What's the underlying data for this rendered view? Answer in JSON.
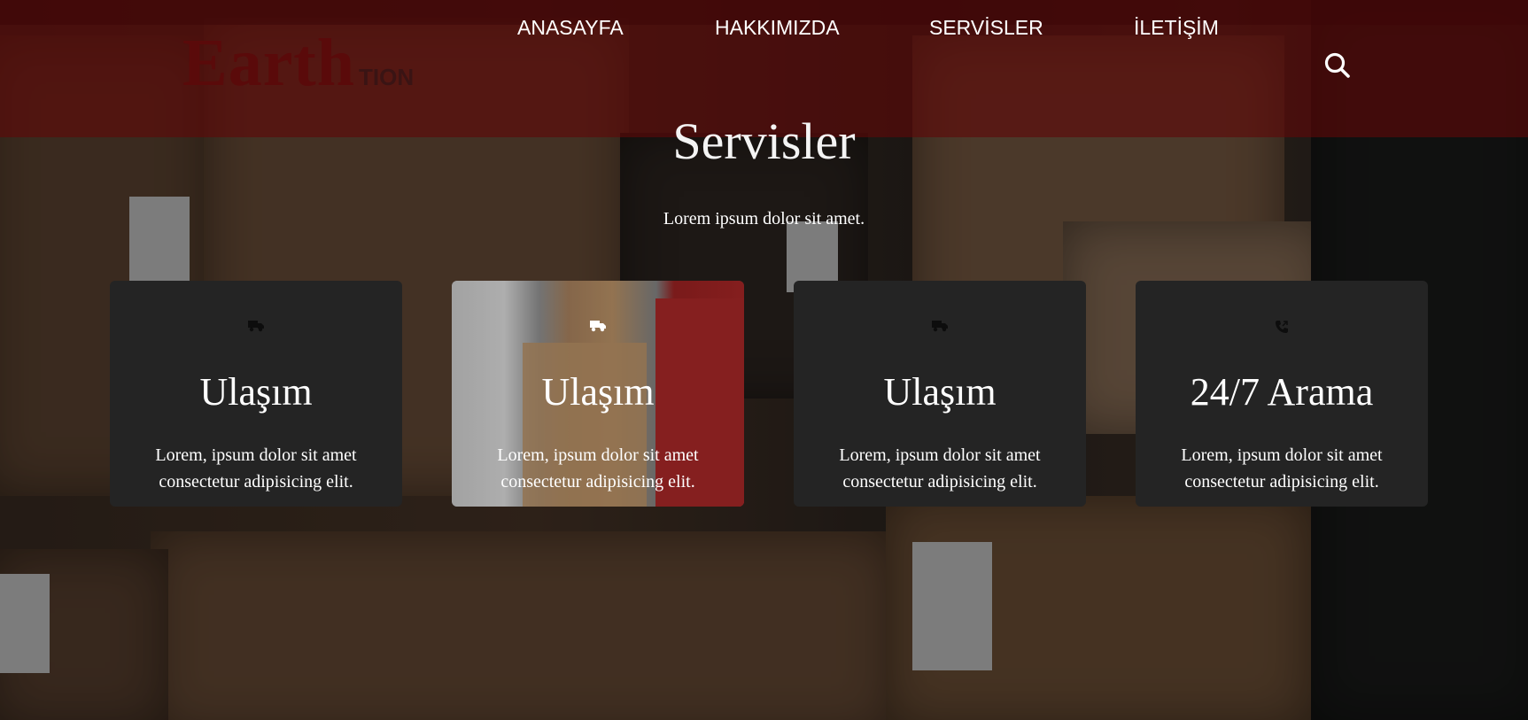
{
  "brand": {
    "logo_main": "Earth",
    "logo_sub": "TION",
    "logo_color": "#5a0a0a"
  },
  "nav": {
    "items": [
      {
        "label": "ANASAYFA"
      },
      {
        "label": "HAKKIMIZDA"
      },
      {
        "label": "SERVİSLER"
      },
      {
        "label": "İLETİŞİM"
      }
    ],
    "search_icon": "search-icon"
  },
  "section": {
    "title": "Servisler",
    "subtitle": "Lorem ipsum dolor sit amet."
  },
  "cards": [
    {
      "icon": "truck-icon",
      "title": "Ulaşım",
      "text": "Lorem, ipsum dolor sit amet consectetur adipisicing elit.",
      "active": false
    },
    {
      "icon": "truck-icon",
      "title": "Ulaşım",
      "text": "Lorem, ipsum dolor sit amet consectetur adipisicing elit.",
      "active": true
    },
    {
      "icon": "truck-icon",
      "title": "Ulaşım",
      "text": "Lorem, ipsum dolor sit amet consectetur adipisicing elit.",
      "active": false
    },
    {
      "icon": "phone-icon",
      "title": "24/7 Arama",
      "text": "Lorem, ipsum dolor sit amet consectetur adipisicing elit.",
      "active": false
    }
  ],
  "colors": {
    "header_overlay": "#5f0808",
    "card_bg": "#242424",
    "text": "#ffffff"
  }
}
